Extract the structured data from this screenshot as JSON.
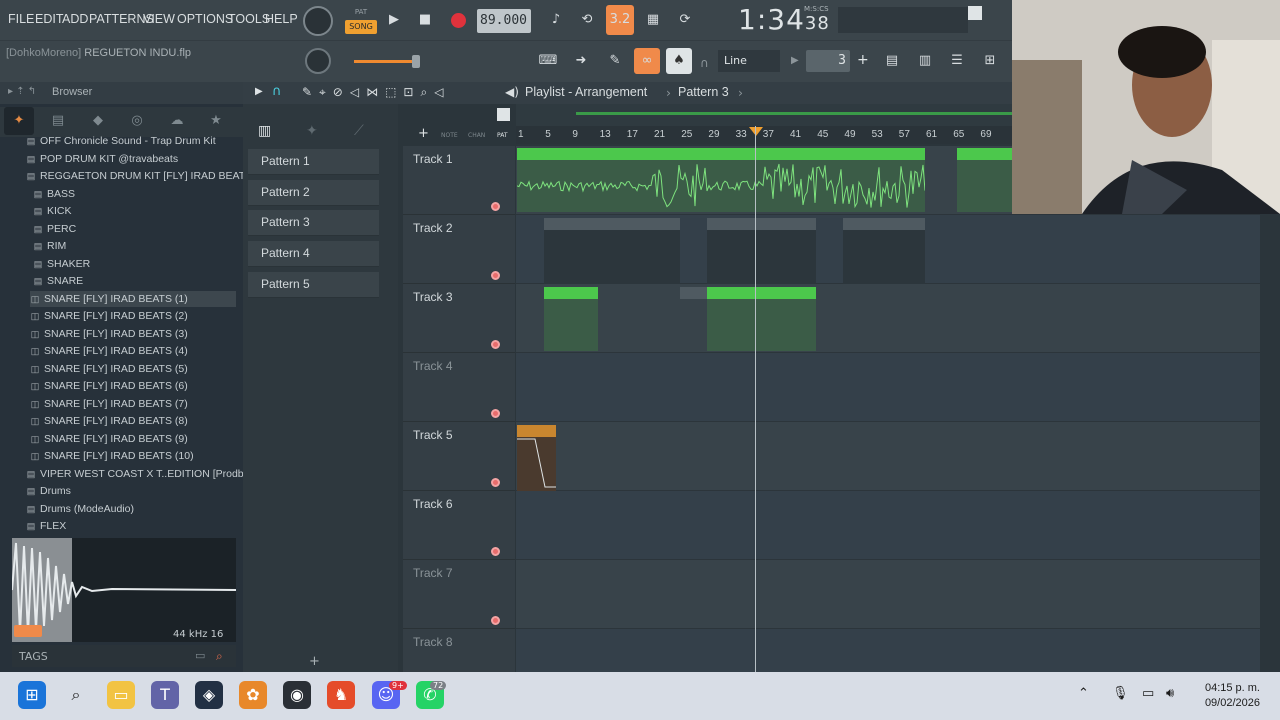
{
  "menu": [
    "FILE",
    "EDIT",
    "ADD",
    "PATTERNS",
    "VIEW",
    "OPTIONS",
    "TOOLS",
    "HELP"
  ],
  "transport": {
    "mode_pat": "PAT",
    "mode_song": "SONG",
    "tempo": "89.000",
    "time_main": "1:34",
    "time_small": "38",
    "time_unit": "M:S:CS",
    "snap": "Line",
    "step": "3"
  },
  "project": {
    "user": "[DohkoMoreno]",
    "file": "REGUETON INDU.flp"
  },
  "browser": {
    "title": "Browser",
    "items": [
      {
        "label": "OFF Chronicle Sound - Trap Drum Kit",
        "indent": 1
      },
      {
        "label": "POP DRUM KIT @travabeats",
        "indent": 1
      },
      {
        "label": "REGGAETON DRUM KIT [FLY] IRAD BEATS",
        "indent": 1
      },
      {
        "label": "BASS",
        "indent": 2
      },
      {
        "label": "KICK",
        "indent": 2
      },
      {
        "label": "PERC",
        "indent": 2
      },
      {
        "label": "RIM",
        "indent": 2
      },
      {
        "label": "SHAKER",
        "indent": 2
      },
      {
        "label": "SNARE",
        "indent": 2
      },
      {
        "label": "SNARE [FLY] IRAD BEATS (1)",
        "indent": 3
      },
      {
        "label": "SNARE [FLY] IRAD BEATS (2)",
        "indent": 3
      },
      {
        "label": "SNARE [FLY] IRAD BEATS (3)",
        "indent": 3
      },
      {
        "label": "SNARE [FLY] IRAD BEATS (4)",
        "indent": 3
      },
      {
        "label": "SNARE [FLY] IRAD BEATS (5)",
        "indent": 3
      },
      {
        "label": "SNARE [FLY] IRAD BEATS (6)",
        "indent": 3
      },
      {
        "label": "SNARE [FLY] IRAD BEATS (7)",
        "indent": 3
      },
      {
        "label": "SNARE [FLY] IRAD BEATS (8)",
        "indent": 3
      },
      {
        "label": "SNARE [FLY] IRAD BEATS (9)",
        "indent": 3
      },
      {
        "label": "SNARE [FLY] IRAD BEATS (10)",
        "indent": 3
      },
      {
        "label": "VIPER WEST COAST X T..EDITION [Prodbymed]",
        "indent": 1
      },
      {
        "label": "Drums",
        "indent": 1
      },
      {
        "label": "Drums (ModeAudio)",
        "indent": 1
      },
      {
        "label": "FLEX",
        "indent": 1
      }
    ],
    "sample_info": "44 kHz 16",
    "tags": "TAGS"
  },
  "playlist": {
    "title": "Playlist - Arrangement",
    "pattern": "Pattern 3",
    "patterns": [
      "Pattern 1",
      "Pattern 2",
      "Pattern 3",
      "Pattern 4",
      "Pattern 5"
    ],
    "tracks": [
      "Track 1",
      "Track 2",
      "Track 3",
      "Track 4",
      "Track 5",
      "Track 6",
      "Track 7",
      "Track 8"
    ],
    "ruler": [
      "1",
      "5",
      "9",
      "13",
      "17",
      "21",
      "25",
      "29",
      "33",
      "37",
      "41",
      "45",
      "49",
      "53",
      "57",
      "61",
      "65",
      "69"
    ],
    "picker_labels": {
      "notes": "NOTE",
      "chan": "CHAN",
      "pat": "PAT"
    }
  },
  "taskbar": {
    "time": "04:15 p. m.",
    "date": "09/02/2026",
    "discord_badge": "9+",
    "whatsapp_badge": "72"
  }
}
